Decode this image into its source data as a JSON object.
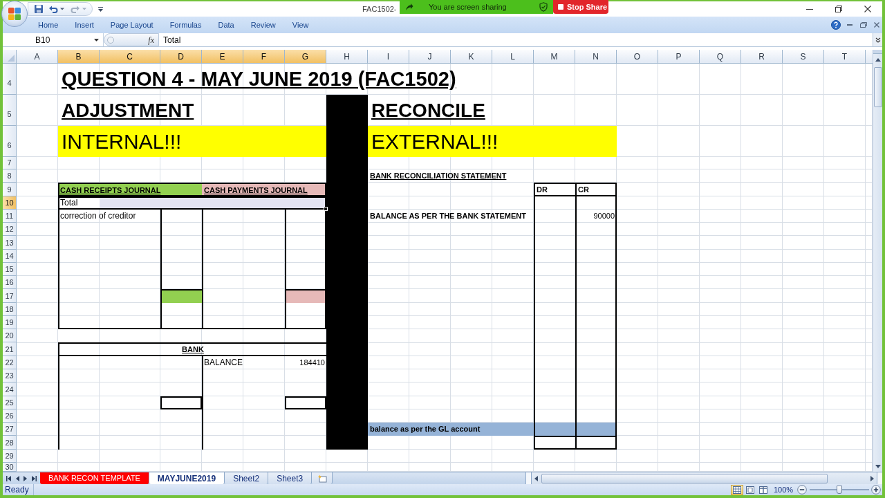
{
  "screen_share": {
    "status": "You are screen sharing",
    "stop_button": "Stop Share"
  },
  "window": {
    "title": "FAC1502-"
  },
  "ribbon_tabs": [
    "Home",
    "Insert",
    "Page Layout",
    "Formulas",
    "Data",
    "Review",
    "View"
  ],
  "formula_bar": {
    "name_box": "B10",
    "function_button": "fx",
    "formula": "Total"
  },
  "column_headers": [
    {
      "label": "A",
      "selected": false
    },
    {
      "label": "B",
      "selected": true
    },
    {
      "label": "C",
      "selected": true
    },
    {
      "label": "D",
      "selected": true
    },
    {
      "label": "E",
      "selected": true
    },
    {
      "label": "F",
      "selected": true
    },
    {
      "label": "G",
      "selected": true
    },
    {
      "label": "H",
      "selected": false
    },
    {
      "label": "I",
      "selected": false
    },
    {
      "label": "J",
      "selected": false
    },
    {
      "label": "K",
      "selected": false
    },
    {
      "label": "L",
      "selected": false
    },
    {
      "label": "M",
      "selected": false
    },
    {
      "label": "N",
      "selected": false
    },
    {
      "label": "O",
      "selected": false
    },
    {
      "label": "P",
      "selected": false
    },
    {
      "label": "Q",
      "selected": false
    },
    {
      "label": "R",
      "selected": false
    },
    {
      "label": "S",
      "selected": false
    },
    {
      "label": "T",
      "selected": false
    }
  ],
  "row_headers": [
    {
      "label": "4",
      "selected": false
    },
    {
      "label": "5",
      "selected": false
    },
    {
      "label": "6",
      "selected": false
    },
    {
      "label": "7",
      "selected": false
    },
    {
      "label": "8",
      "selected": false
    },
    {
      "label": "9",
      "selected": false
    },
    {
      "label": "10",
      "selected": true
    },
    {
      "label": "11",
      "selected": false
    },
    {
      "label": "12",
      "selected": false
    },
    {
      "label": "13",
      "selected": false
    },
    {
      "label": "14",
      "selected": false
    },
    {
      "label": "15",
      "selected": false
    },
    {
      "label": "16",
      "selected": false
    },
    {
      "label": "17",
      "selected": false
    },
    {
      "label": "18",
      "selected": false
    },
    {
      "label": "19",
      "selected": false
    },
    {
      "label": "20",
      "selected": false
    },
    {
      "label": "21",
      "selected": false
    },
    {
      "label": "22",
      "selected": false
    },
    {
      "label": "23",
      "selected": false
    },
    {
      "label": "24",
      "selected": false
    },
    {
      "label": "25",
      "selected": false
    },
    {
      "label": "26",
      "selected": false
    },
    {
      "label": "27",
      "selected": false
    },
    {
      "label": "28",
      "selected": false
    },
    {
      "label": "29",
      "selected": false
    },
    {
      "label": "30",
      "selected": false
    }
  ],
  "sheet": {
    "title": "QUESTION 4 - MAY JUNE 2019 (FAC1502)",
    "adjustment": {
      "heading": "ADJUSTMENT",
      "banner": "INTERNAL!!!"
    },
    "reconcile": {
      "heading": "RECONCILE",
      "banner": "EXTERNAL!!!"
    },
    "cash_receipts_journal": {
      "title": "CASH RECEIPTS JOURNAL"
    },
    "cash_payments_journal": {
      "title": "CASH PAYMENTS JOURNAL"
    },
    "journal_rows": [
      {
        "description": "Total",
        "selected": true
      },
      {
        "description": "correction of creditor",
        "selected": false
      }
    ],
    "bank_account": {
      "title": "BANK",
      "credit_entries": [
        {
          "description": "BALANCE",
          "amount": "184410"
        }
      ]
    },
    "bank_reconciliation": {
      "title": "BANK RECONCILIATION STATEMENT",
      "columns": [
        "DR",
        "CR"
      ],
      "rows": [
        {
          "description": "BALANCE AS PER THE BANK STATEMENT",
          "cr": "90000"
        }
      ],
      "closing_row": "balance as per the GL account"
    }
  },
  "sheet_tabs": [
    {
      "label": "BANK RECON TEMPLATE",
      "selected": false,
      "color": "#ff0000"
    },
    {
      "label": "MAYJUNE2019",
      "selected": true
    },
    {
      "label": "Sheet2",
      "selected": false
    },
    {
      "label": "Sheet3",
      "selected": false
    }
  ],
  "status_bar": {
    "mode": "Ready",
    "views": [
      {
        "kind": "normal",
        "selected": true
      },
      {
        "kind": "page_layout",
        "selected": false
      },
      {
        "kind": "page_break",
        "selected": false
      }
    ],
    "zoom": "100%",
    "zoom_slider": {
      "level": 0.5
    }
  }
}
